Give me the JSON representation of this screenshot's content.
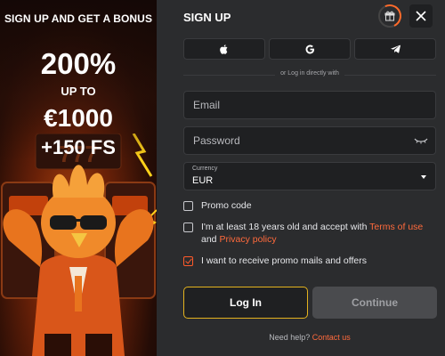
{
  "promo": {
    "headline": "SIGN UP AND GET A BONUS",
    "percent": "200%",
    "up_to": "UP TO",
    "amount": "€1000",
    "free_spins": "+150 FS"
  },
  "header": {
    "title": "SIGN UP"
  },
  "social": {
    "apple_icon": "apple-icon",
    "google_icon": "google-icon",
    "telegram_icon": "telegram-icon"
  },
  "divider": "or Log in directly with",
  "form": {
    "email_placeholder": "Email",
    "password_placeholder": "Password",
    "currency_label": "Currency",
    "currency_value": "EUR"
  },
  "checks": {
    "promo_code": "Promo code",
    "age_text_1": "I'm at least 18 years old and accept with ",
    "terms_link": "Terms of use",
    "age_and": " and ",
    "privacy_link": "Privacy policy",
    "mails": "I want to receive promo mails and offers"
  },
  "buttons": {
    "login": "Log In",
    "continue": "Continue"
  },
  "help": {
    "text": "Need help? ",
    "link": "Contact us"
  },
  "colors": {
    "accent": "#ff6a3c",
    "login_border": "#e3b21e",
    "panel_bg": "#2b2c2e"
  }
}
